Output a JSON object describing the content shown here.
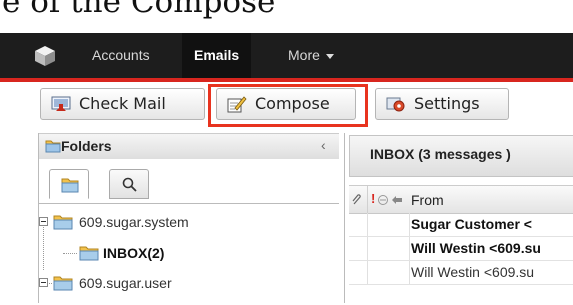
{
  "caption": {
    "text": "e of the Compose"
  },
  "navbar": {
    "tabs": [
      {
        "label": "Accounts",
        "active": false
      },
      {
        "label": "Emails",
        "active": true
      },
      {
        "label": "More",
        "active": false
      }
    ]
  },
  "toolbar": {
    "check_mail": "Check Mail",
    "compose": "Compose",
    "settings": "Settings"
  },
  "folders": {
    "title": "Folders",
    "tree": [
      {
        "label": "609.sugar.system",
        "bold": false
      },
      {
        "label": "INBOX(2)",
        "bold": true
      },
      {
        "label": "609.sugar.user",
        "bold": false
      }
    ]
  },
  "inbox": {
    "title": "INBOX (3 messages )",
    "columns": {
      "from": "From"
    },
    "rows": [
      {
        "from": "Sugar Customer <",
        "bold": true
      },
      {
        "from": "Will Westin <609.su",
        "bold": true
      },
      {
        "from": "Will Westin <609.su",
        "bold": false
      }
    ]
  },
  "colors": {
    "nav_bg": "#1d1d1d",
    "accent_red": "#d8261f",
    "highlight": "#e8331f"
  }
}
